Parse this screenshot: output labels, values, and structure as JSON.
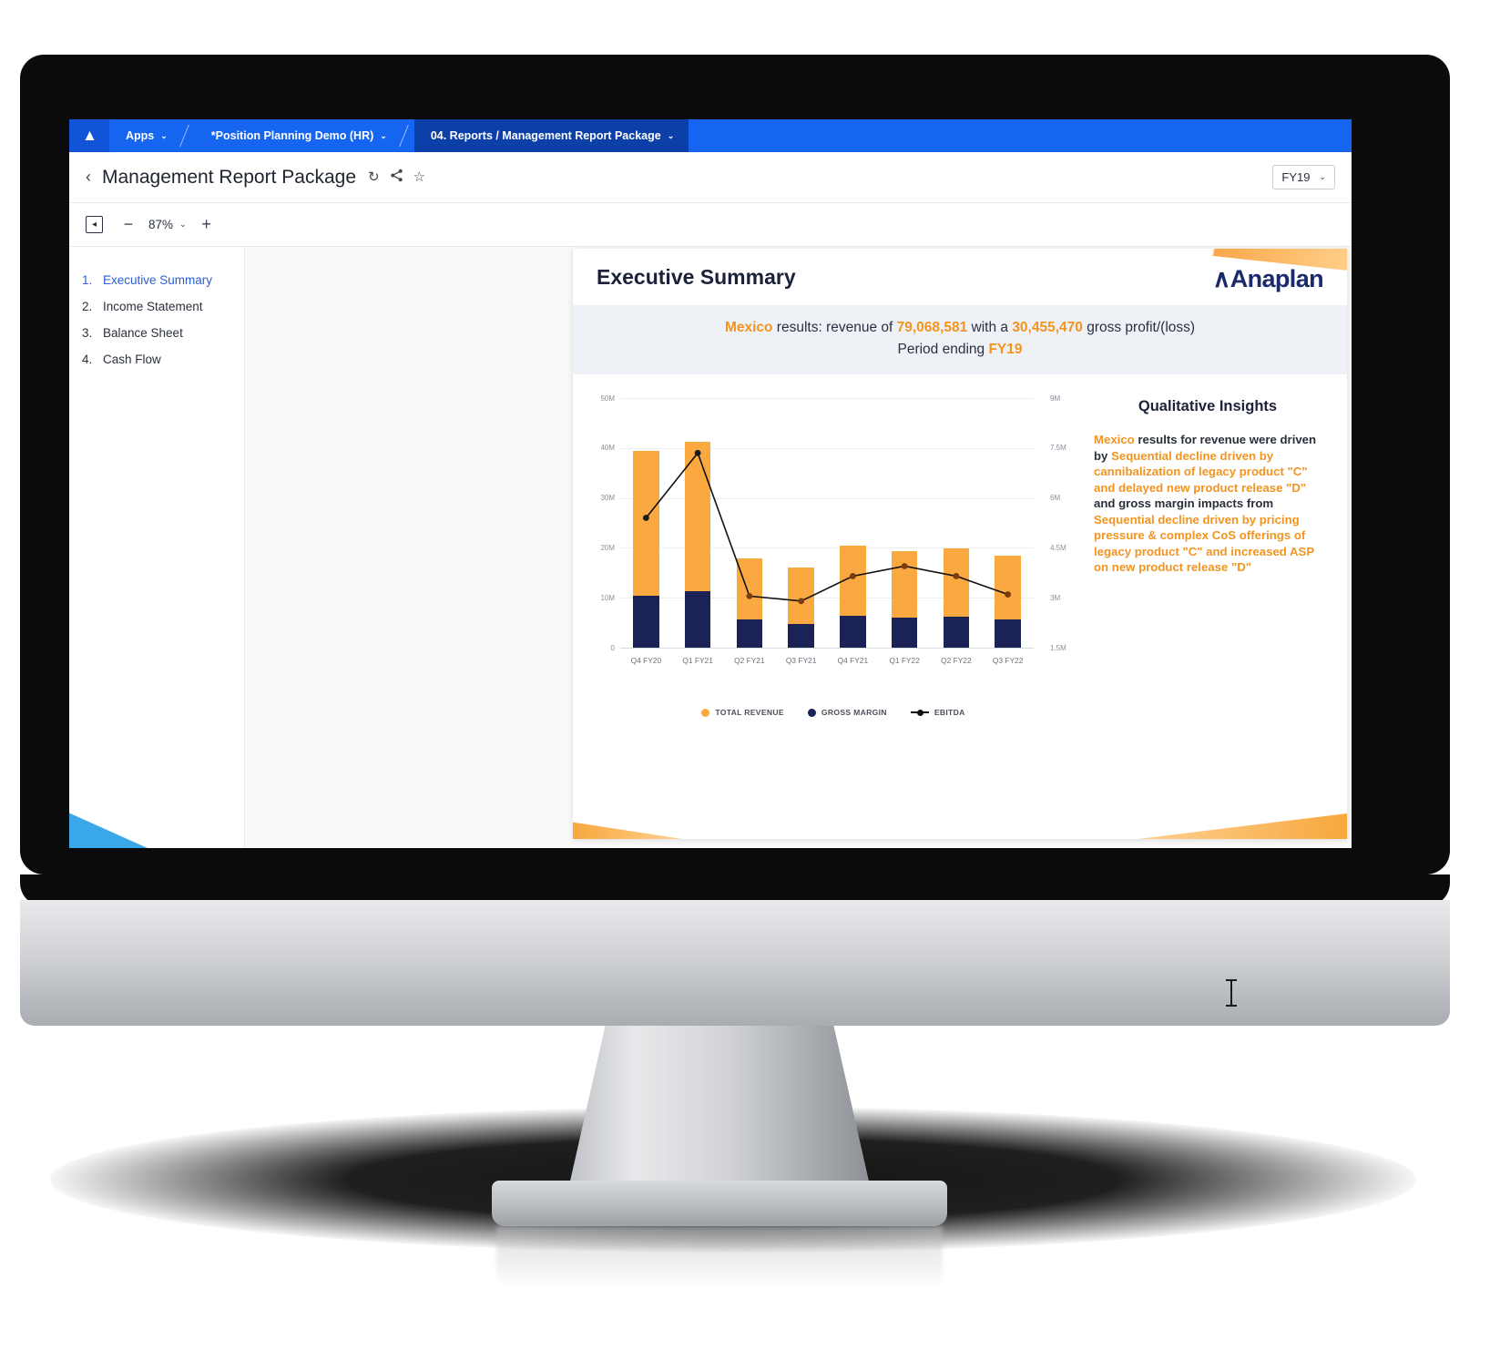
{
  "top_nav": {
    "logo": "anaplan-logo",
    "crumbs": [
      {
        "label": "Apps",
        "caret": "⌄"
      },
      {
        "label": "*Position Planning Demo (HR)",
        "caret": "⌄"
      },
      {
        "label": "04. Reports / Management Report Package",
        "caret": "⌄"
      }
    ]
  },
  "title_bar": {
    "back": "‹",
    "title": "Management Report Package",
    "refresh_icon": "↻",
    "share_icon": "☀",
    "favorite_icon": "☆",
    "fy_select": {
      "value": "FY19",
      "caret": "⌄"
    }
  },
  "toolbar": {
    "panel_toggle_icon": "◧",
    "zoom_out": "−",
    "zoom_value": "87%",
    "zoom_caret": "⌄",
    "zoom_in": "+"
  },
  "outline": {
    "items": [
      {
        "num": "1.",
        "label": "Executive Summary",
        "selected": true
      },
      {
        "num": "2.",
        "label": "Income Statement",
        "selected": false
      },
      {
        "num": "3.",
        "label": "Balance Sheet",
        "selected": false
      },
      {
        "num": "4.",
        "label": "Cash Flow",
        "selected": false
      }
    ]
  },
  "report": {
    "title": "Executive Summary",
    "brand": "Anaplan",
    "subtitle": {
      "line1_a": "Mexico",
      "line1_b": " results: revenue of ",
      "line1_c": "79,068,581",
      "line1_d": " with a ",
      "line1_e": "30,455,470",
      "line1_f": " gross profit/(loss)",
      "line2_a": "Period ending ",
      "line2_b": "FY19"
    },
    "insights": {
      "title": "Qualitative Insights",
      "segments": [
        {
          "text": "Mexico",
          "orange": true
        },
        {
          "text": " results for revenue were driven by ",
          "orange": false
        },
        {
          "text": "Sequential decline driven by cannibalization of legacy product \"C\" and delayed new product release \"D\"",
          "orange": true
        },
        {
          "text": " and gross margin impacts from ",
          "orange": false
        },
        {
          "text": "Sequential decline driven by pricing pressure & complex CoS offerings of legacy product \"C\" and increased ASP on new product release \"D\"",
          "orange": true
        }
      ]
    }
  },
  "chart_data": {
    "type": "bar",
    "title": "",
    "categories": [
      "Q4 FY20",
      "Q1 FY21",
      "Q2 FY21",
      "Q3 FY21",
      "Q4 FY21",
      "Q1 FY22",
      "Q2 FY22",
      "Q3 FY22"
    ],
    "series": [
      {
        "name": "TOTAL REVENUE",
        "color": "#f9a93f",
        "axis": "left",
        "values": [
          39500000,
          41300000,
          17800000,
          16100000,
          20400000,
          19400000,
          19900000,
          18400000
        ]
      },
      {
        "name": "GROSS MARGIN",
        "color": "#1b2256",
        "axis": "left",
        "values": [
          10400000,
          11300000,
          5600000,
          4800000,
          6400000,
          6000000,
          6300000,
          5700000
        ]
      },
      {
        "name": "EBITDA",
        "color": "#111111",
        "axis": "right",
        "values": [
          5400000,
          7350000,
          3050000,
          2900000,
          3650000,
          3950000,
          3650000,
          3100000
        ]
      }
    ],
    "left_axis": {
      "ticks": [
        "0",
        "10M",
        "20M",
        "30M",
        "40M",
        "50M"
      ],
      "min": 0,
      "max": 50000000
    },
    "right_axis": {
      "ticks": [
        "1.5M",
        "3M",
        "4.5M",
        "6M",
        "7.5M",
        "9M"
      ],
      "min": 1500000,
      "max": 9000000
    },
    "legend": [
      {
        "label": "TOTAL REVENUE",
        "marker": "dot",
        "color": "#f9a93f"
      },
      {
        "label": "GROSS MARGIN",
        "marker": "dot",
        "color": "#1b2256"
      },
      {
        "label": "EBITDA",
        "marker": "line",
        "color": "#111111"
      }
    ],
    "legend_position": "bottom",
    "grid": true,
    "xlabel": "",
    "ylabel": ""
  }
}
